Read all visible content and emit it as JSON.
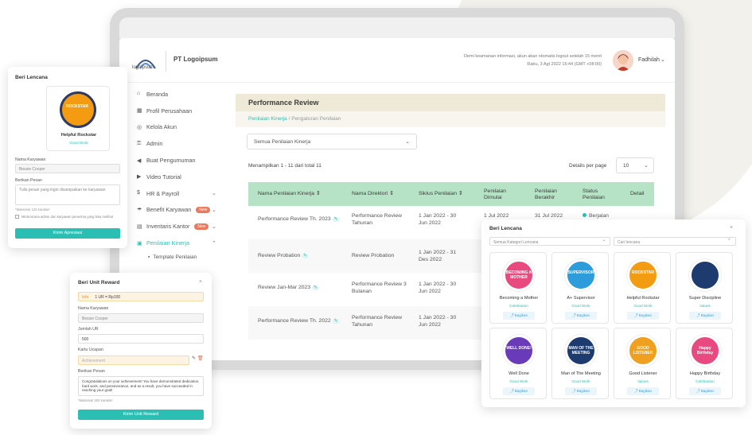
{
  "app": {
    "company_name": "PT Logoipsum",
    "logo_text": "logoipsum",
    "security_info": "Demi keamanan informasi, akun akan otomatis logout setelah 15 menit",
    "datetime": "Rabu, 3 Agt 2022 16:44 (GMT +08:00)",
    "user_name": "Fadhilah"
  },
  "sidebar": {
    "items": [
      {
        "label": "Beranda",
        "icon": "home-icon"
      },
      {
        "label": "Profil Perusahaan",
        "icon": "building-icon"
      },
      {
        "label": "Kelola Akun",
        "icon": "account-icon"
      },
      {
        "label": "Admin",
        "icon": "key-icon"
      },
      {
        "label": "Buat Pengumuman",
        "icon": "megaphone-icon"
      },
      {
        "label": "Video Tutorial",
        "icon": "video-icon"
      },
      {
        "label": "HR & Payroll",
        "icon": "payroll-icon"
      },
      {
        "label": "Benefit Karyawan",
        "icon": "umbrella-icon",
        "badge": "New"
      },
      {
        "label": "Inventaris Kantor",
        "icon": "inventory-icon",
        "badge": "New"
      },
      {
        "label": "Penilaian Kinerja",
        "icon": "clipboard-icon"
      }
    ],
    "sub_item": "Template Penilaian"
  },
  "main": {
    "title": "Performance Review",
    "breadcrumb_1": "Penilaian Kinerja",
    "breadcrumb_sep": "/",
    "breadcrumb_2": "Pengaturan Penilaian",
    "filter_value": "Semua Penilaian Kinerja",
    "showing": "Menampilkan 1 - 11 dari total 11",
    "details_per_page_label": "Details per page",
    "details_per_page_value": "10",
    "columns": [
      "Nama Penilaian Kinerja",
      "Nama Direktori",
      "Siklus Penilaian",
      "Penilaian Dimulai",
      "Penilaian Berakhir",
      "Status Penilaian",
      "Detail"
    ],
    "rows": [
      {
        "name": "Performance Review Th. 2023",
        "directory": "Performance Review Tahunan",
        "cycle": "1 Jan 2022 - 30 Jun 2022",
        "start": "1 Jul 2022",
        "end": "31 Jul 2022",
        "status": "Berjalan"
      },
      {
        "name": "Review Probation",
        "directory": "Review Probation",
        "cycle": "1 Jan 2022 - 31 Des 2022",
        "start": "",
        "end": "",
        "status": ""
      },
      {
        "name": "Review Jan-Mar 2023",
        "directory": "Performance Review 3 Bulanan",
        "cycle": "1 Jan 2022 - 30 Jun 2022",
        "start": "",
        "end": "",
        "status": ""
      },
      {
        "name": "Performance Review Th. 2022",
        "directory": "Performance Review Tahunan",
        "cycle": "1 Jan 2022 - 30 Jun 2022",
        "start": "",
        "end": "",
        "status": ""
      }
    ]
  },
  "beri_lencana_small": {
    "title": "Beri Lencana",
    "badge_name": "Helpful Rockstar",
    "badge_category": "Good Work",
    "badge_text": "ROCKSTAR",
    "employee_label": "Nama Karyawan",
    "employee_value": "Bessie Cooper",
    "message_label": "Berikan Pesan",
    "message_placeholder": "Tulis pesan yang ingin disampaikan ke karyawan",
    "max_chars": "*Maksimal 120 karakter",
    "checkbox_label": "Minta kirana admin dan karyawan penerima yang bisa melihat",
    "submit": "Kirim Apresiasi"
  },
  "beri_unit_reward": {
    "title": "Beri Unit Reward",
    "info_tag": "Info",
    "info_text": "1 UR = Rp100",
    "employee_label": "Nama Karyawan",
    "employee_value": "Bessie Cooper",
    "amount_label": "Jumlah UR",
    "amount_value": "500",
    "card_label": "Kartu Ucapan",
    "card_value": "Achievement",
    "message_label": "Berikan Pesan",
    "message_value": "Congratulations on your achievement! You have demonstrated dedication, hard work, and perseverance, and as a result, you have succeeded in reaching your goal!",
    "max_chars": "*Maksimal 250 karakter",
    "submit": "Kirim Unit Reward"
  },
  "beri_lencana_large": {
    "title": "Beri Lencana",
    "filter_placeholder": "Semua Kategori Lencana",
    "search_placeholder": "Cari lencana",
    "share_label": "Bagikan",
    "badges": [
      {
        "name": "Becoming a Mother",
        "category": "Celebration",
        "art_text": "BECOMING A MOTHER",
        "color": "#e84a7f"
      },
      {
        "name": "A+ Supervisor",
        "category": "Good Work",
        "art_text": "SUPERVISOR",
        "color": "#2d9cdb"
      },
      {
        "name": "Helpful Rockstar",
        "category": "Good Work",
        "art_text": "ROCKSTAR",
        "color": "#f39c12"
      },
      {
        "name": "Super Discipline",
        "category": "Values",
        "art_text": "",
        "color": "#1d3b6e"
      },
      {
        "name": "Well Done",
        "category": "Good Work",
        "art_text": "WELL DONE!",
        "color": "#6a3bb8"
      },
      {
        "name": "Man of The Meeting",
        "category": "Good Work",
        "art_text": "MAN OF THE MEETING",
        "color": "#1d3b6e"
      },
      {
        "name": "Good Listener",
        "category": "Values",
        "art_text": "GOOD LISTENER",
        "color": "#f0a020"
      },
      {
        "name": "Happy Birthday",
        "category": "Celebration",
        "art_text": "Happy Birthday",
        "color": "#e84a7f"
      }
    ]
  }
}
